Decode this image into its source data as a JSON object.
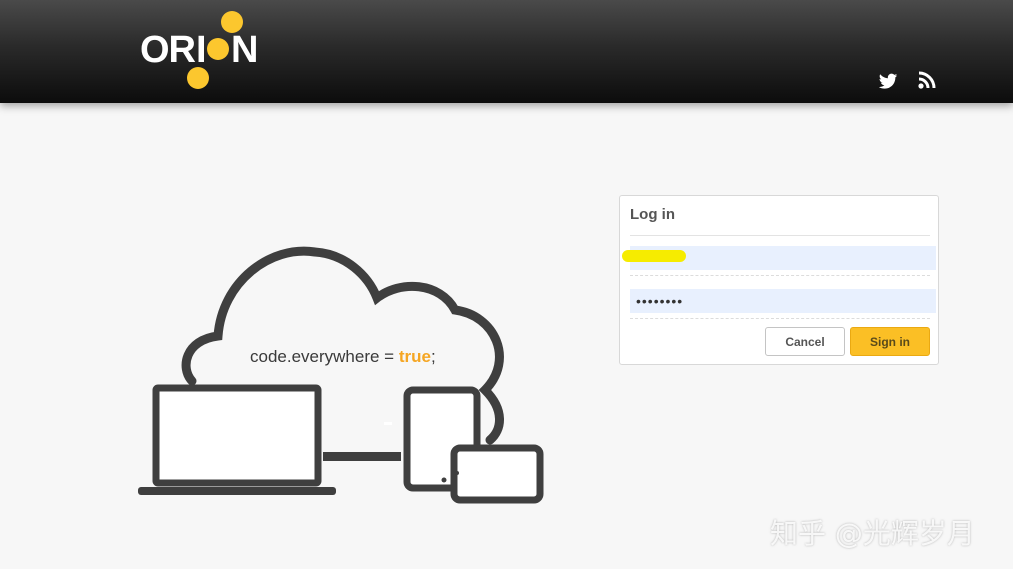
{
  "header": {
    "logo_text": "ORION",
    "social": [
      {
        "icon": "twitter-icon"
      },
      {
        "icon": "rss-icon"
      }
    ]
  },
  "hero": {
    "caption_code": "code.everywhere = ",
    "caption_value": "true",
    "caption_end": ";"
  },
  "login": {
    "title": "Log in",
    "username_value": "",
    "password_value": "••••••••",
    "cancel_label": "Cancel",
    "signin_label": "Sign in"
  },
  "watermark": {
    "text": "知乎 @光辉岁月"
  },
  "colors": {
    "accent": "#fbbf25",
    "logo_dot": "#fcc72e",
    "header_dark": "#0c0c0c",
    "autofill": "#e8f0fe"
  }
}
